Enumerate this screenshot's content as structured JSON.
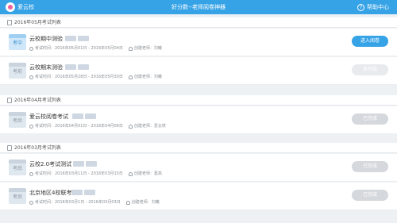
{
  "header": {
    "brand": "爱云校",
    "title": "好分数--老师阅卷神器",
    "help": "帮助中心",
    "help_glyph": "?"
  },
  "groups": [
    {
      "label": "2016年05月考试列表",
      "rows": [
        {
          "badge": "考中",
          "name": "云校期中测验",
          "time": "考试时间：2016年05月01日 - 2016年05月04日",
          "creator": "创建老师：刘曦",
          "button": "进入阅卷",
          "state": "primary"
        },
        {
          "badge": "考前",
          "name": "云校期末测验",
          "time": "考试时间：2016年05月28日 - 2016年05月30日",
          "creator": "创建老师：刘曦",
          "button": "未开始",
          "state": "disabled"
        }
      ]
    },
    {
      "label": "2016年04月考试列表",
      "rows": [
        {
          "badge": "考后",
          "name": "爱云校阅卷考试",
          "time": "考试时间：2016年04月01日 - 2016年04月06日",
          "creator": "创建老师：爱云校",
          "button": "已完成",
          "state": "done"
        }
      ]
    },
    {
      "label": "2016年03月考试列表",
      "rows": [
        {
          "badge": "考后",
          "name": "云校2.0考试测试",
          "time": "考试时间：2016年03月11日 - 2016年03月15日",
          "creator": "创建老师：葛高",
          "button": "已完成",
          "state": "done"
        },
        {
          "badge": "考后",
          "name": "北京地区4校联考",
          "time": "考试时间：2016年03月1日 - 2016年03月03日",
          "creator": "创建老师：刘曦",
          "button": "已完成",
          "state": "done"
        }
      ]
    }
  ],
  "colors": {
    "accent": "#37a3e7",
    "done": "#d5d8dc",
    "disabled": "#e8eaed"
  },
  "icons": [
    "exam-badge-icon",
    "clock-icon",
    "person-icon",
    "calendar-icon",
    "help-icon",
    "logo-icon"
  ]
}
